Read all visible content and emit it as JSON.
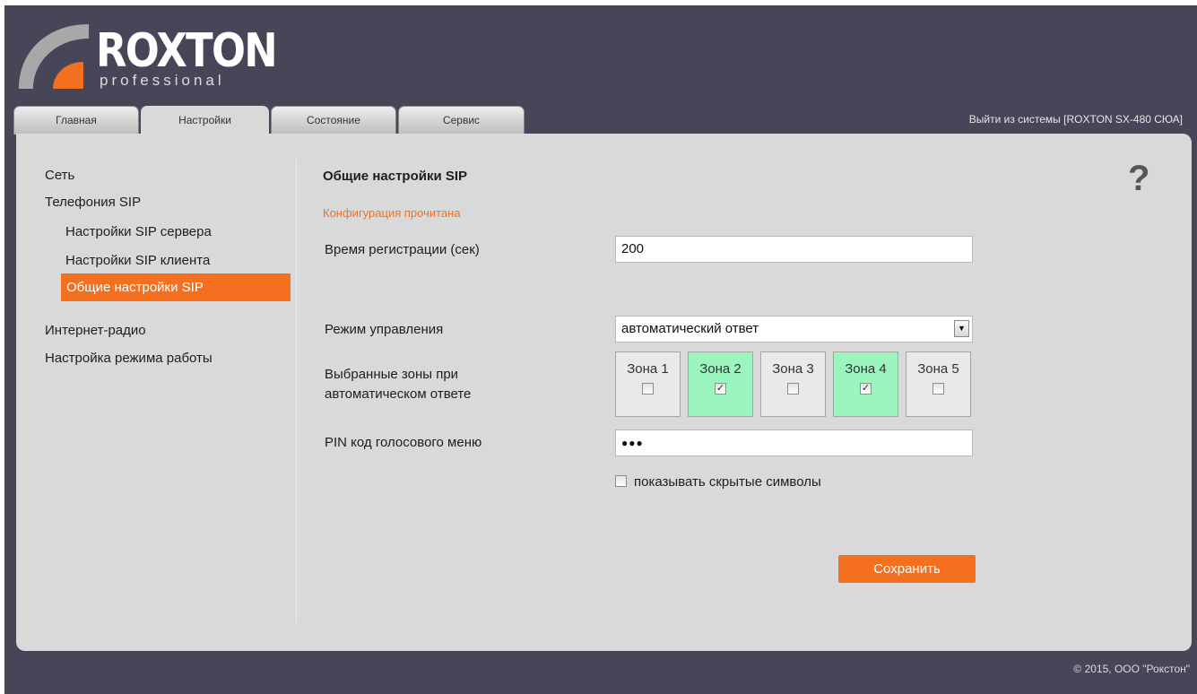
{
  "brand": {
    "name": "ROXTON",
    "subtitle": "professional"
  },
  "tabs": [
    {
      "label": "Главная"
    },
    {
      "label": "Настройки"
    },
    {
      "label": "Состояние"
    },
    {
      "label": "Сервис"
    }
  ],
  "header": {
    "logout": "Выйти из системы [ROXTON SX-480 СЮА]"
  },
  "sidebar": {
    "items": [
      {
        "label": "Сеть"
      },
      {
        "label": "Телефония SIP"
      },
      {
        "label": "Настройки SIP сервера"
      },
      {
        "label": "Настройки SIP клиента"
      },
      {
        "label": "Общие настройки SIP"
      },
      {
        "label": "Интернет-радио"
      },
      {
        "label": "Настройка режима работы"
      }
    ]
  },
  "main": {
    "title": "Общие настройки SIP",
    "status": "Конфигурация прочитана",
    "help": "?",
    "reg_time": {
      "label": "Время регистрации (сек)",
      "value": "200"
    },
    "control_mode": {
      "label": "Режим управления",
      "value": "автоматический ответ"
    },
    "zones": {
      "label": "Выбранные зоны при автоматическом ответе",
      "items": [
        {
          "label": "Зона 1",
          "checked": false
        },
        {
          "label": "Зона 2",
          "checked": true
        },
        {
          "label": "Зона 3",
          "checked": false
        },
        {
          "label": "Зона 4",
          "checked": true
        },
        {
          "label": "Зона 5",
          "checked": false
        }
      ]
    },
    "pin": {
      "label": "PIN код голосового меню",
      "value": "●●●"
    },
    "show_hidden": "показывать скрытые символы",
    "save": "Сохранить"
  },
  "footer": {
    "copyright": "© 2015, ООО \"Рокстон\""
  },
  "colors": {
    "accent": "#f37021",
    "zone_selected": "#9cf5bf",
    "header_bg": "#474558"
  },
  "icons": [
    "checkbox-checked-icon",
    "checkbox-unchecked-icon",
    "dropdown-arrow-icon",
    "help-icon"
  ]
}
